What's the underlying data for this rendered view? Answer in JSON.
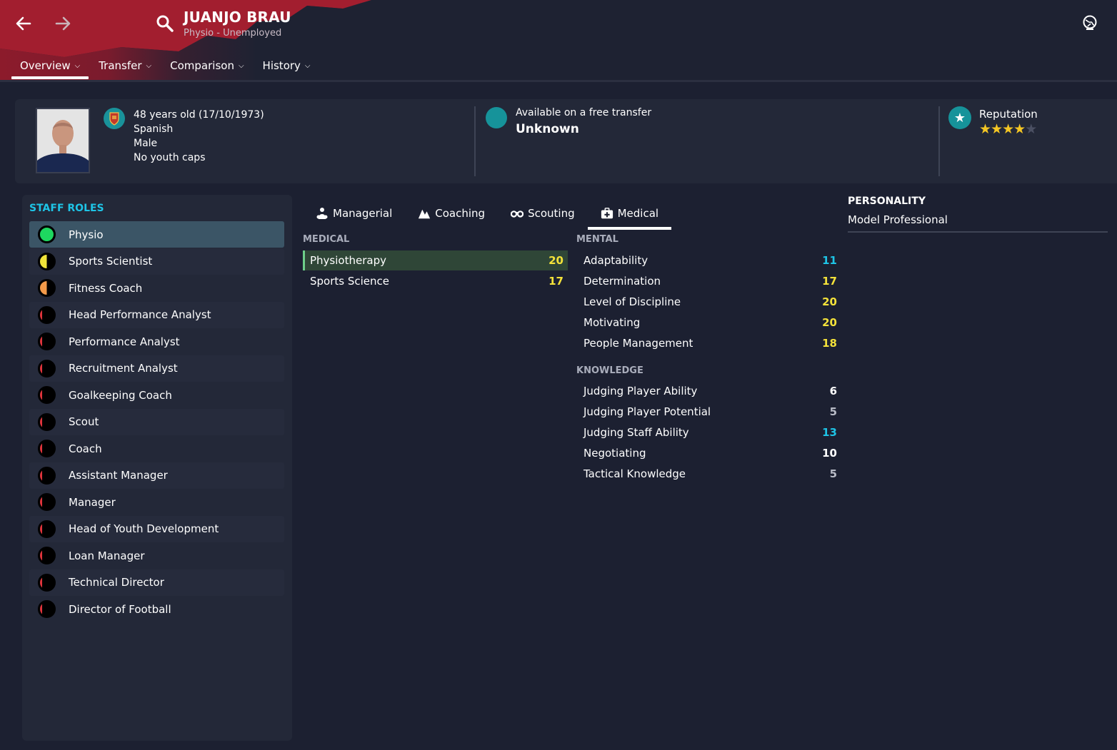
{
  "header": {
    "name": "JUANJO BRAU",
    "subtitle": "Physio - Unemployed",
    "tabs": [
      {
        "label": "Overview",
        "active": true
      },
      {
        "label": "Transfer",
        "active": false
      },
      {
        "label": "Comparison",
        "active": false
      },
      {
        "label": "History",
        "active": false
      }
    ],
    "icons": {
      "back": "arrow-left-icon",
      "forward": "arrow-right-icon",
      "search": "search-icon",
      "globe": "globe-icon"
    }
  },
  "bio": {
    "age_line": "48 years old (17/10/1973)",
    "nationality": "Spanish",
    "gender": "Male",
    "caps": "No youth caps"
  },
  "transfer": {
    "label": "Available on a free transfer",
    "value": "Unknown"
  },
  "reputation": {
    "label": "Reputation",
    "stars": 4,
    "max_stars": 5
  },
  "staff_roles": {
    "title": "STAFF ROLES",
    "items": [
      {
        "label": "Physio",
        "suitability": 1.0,
        "color": "#1ed760"
      },
      {
        "label": "Sports Scientist",
        "suitability": 0.5,
        "color": "#f0e43a"
      },
      {
        "label": "Fitness Coach",
        "suitability": 0.5,
        "color": "#f39a4a"
      },
      {
        "label": "Head Performance Analyst",
        "suitability": 0.15,
        "color": "#e0343c"
      },
      {
        "label": "Performance Analyst",
        "suitability": 0.15,
        "color": "#e0343c"
      },
      {
        "label": "Recruitment Analyst",
        "suitability": 0.15,
        "color": "#e0343c"
      },
      {
        "label": "Goalkeeping Coach",
        "suitability": 0.15,
        "color": "#e0343c"
      },
      {
        "label": "Scout",
        "suitability": 0.15,
        "color": "#e0343c"
      },
      {
        "label": "Coach",
        "suitability": 0.15,
        "color": "#e0343c"
      },
      {
        "label": "Assistant Manager",
        "suitability": 0.15,
        "color": "#e0343c"
      },
      {
        "label": "Manager",
        "suitability": 0.15,
        "color": "#e0343c"
      },
      {
        "label": "Head of Youth Development",
        "suitability": 0.15,
        "color": "#e0343c"
      },
      {
        "label": "Loan Manager",
        "suitability": 0.15,
        "color": "#e0343c"
      },
      {
        "label": "Technical Director",
        "suitability": 0.15,
        "color": "#e0343c"
      },
      {
        "label": "Director of Football",
        "suitability": 0.15,
        "color": "#e0343c"
      }
    ]
  },
  "attr_tabs": [
    {
      "label": "Managerial",
      "icon": "managerial-icon",
      "active": false
    },
    {
      "label": "Coaching",
      "icon": "coaching-icon",
      "active": false
    },
    {
      "label": "Scouting",
      "icon": "binoculars-icon",
      "active": false
    },
    {
      "label": "Medical",
      "icon": "medical-kit-icon",
      "active": true
    }
  ],
  "medical": {
    "title": "MEDICAL",
    "items": [
      {
        "name": "Physiotherapy",
        "value": "20",
        "color": "#f4e23a",
        "highlight": true
      },
      {
        "name": "Sports Science",
        "value": "17",
        "color": "#f4e23a",
        "highlight": false
      }
    ]
  },
  "mental": {
    "title": "MENTAL",
    "items": [
      {
        "name": "Adaptability",
        "value": "11",
        "color": "#1ec4e6"
      },
      {
        "name": "Determination",
        "value": "17",
        "color": "#f4e23a"
      },
      {
        "name": "Level of Discipline",
        "value": "20",
        "color": "#f4e23a"
      },
      {
        "name": "Motivating",
        "value": "20",
        "color": "#f4e23a"
      },
      {
        "name": "People Management",
        "value": "18",
        "color": "#f4e23a"
      }
    ]
  },
  "knowledge": {
    "title": "KNOWLEDGE",
    "items": [
      {
        "name": "Judging Player Ability",
        "value": "6",
        "color": "#ffffff"
      },
      {
        "name": "Judging Player Potential",
        "value": "5",
        "color": "#b9bcc7"
      },
      {
        "name": "Judging Staff Ability",
        "value": "13",
        "color": "#1ec4e6"
      },
      {
        "name": "Negotiating",
        "value": "10",
        "color": "#ffffff"
      },
      {
        "name": "Tactical Knowledge",
        "value": "5",
        "color": "#b9bcc7"
      }
    ]
  },
  "personality": {
    "title": "PERSONALITY",
    "value": "Model Professional"
  }
}
